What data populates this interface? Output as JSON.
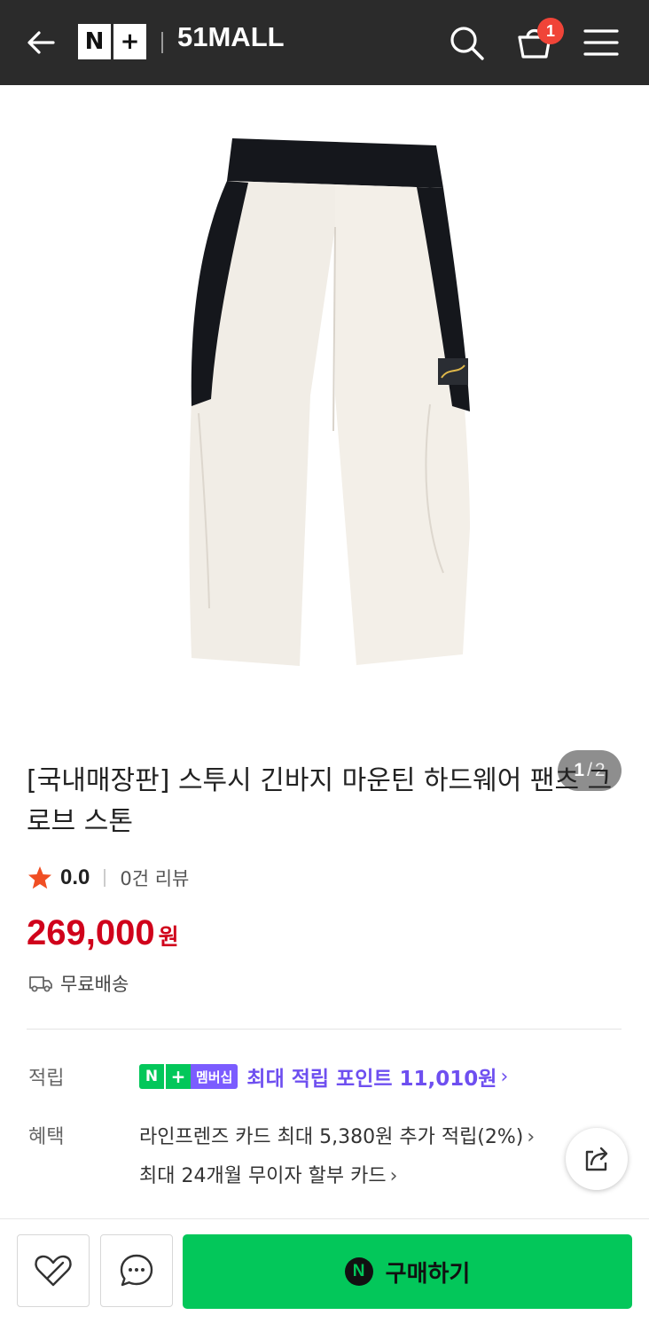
{
  "header": {
    "brand_left": "N",
    "brand_right": "+",
    "mall_name": "51MALL",
    "cart_count": "1",
    "icons": [
      "back-arrow-icon",
      "search-icon",
      "cart-icon",
      "menu-icon"
    ]
  },
  "gallery": {
    "current": "1",
    "total": "2",
    "separator": "/"
  },
  "product": {
    "title": "[국내매장판] 스투시 긴바지 마운틴 하드웨어 팬츠 그로브 스톤",
    "rating": "0.0",
    "review_count": "0건 리뷰",
    "price": "269,000",
    "price_unit": "원",
    "shipping": "무료배송"
  },
  "points": {
    "label": "적립",
    "badge_n": "N",
    "badge_plus": "+",
    "badge_member": "멤버십",
    "text": "최대 적립 포인트 11,010원"
  },
  "benefits": {
    "label": "혜택",
    "items": [
      "라인프렌즈 카드 최대 5,380원 추가 적립(2%)",
      "최대 24개월 무이자 할부 카드"
    ]
  },
  "actions": {
    "buy_icon": "N",
    "buy_label": "구매하기"
  },
  "colors": {
    "header_bg": "#2b2b2b",
    "price": "#d0021b",
    "naver_green": "#03c75a",
    "membership_purple": "#6e4ff0",
    "badge_red": "#f04438"
  }
}
